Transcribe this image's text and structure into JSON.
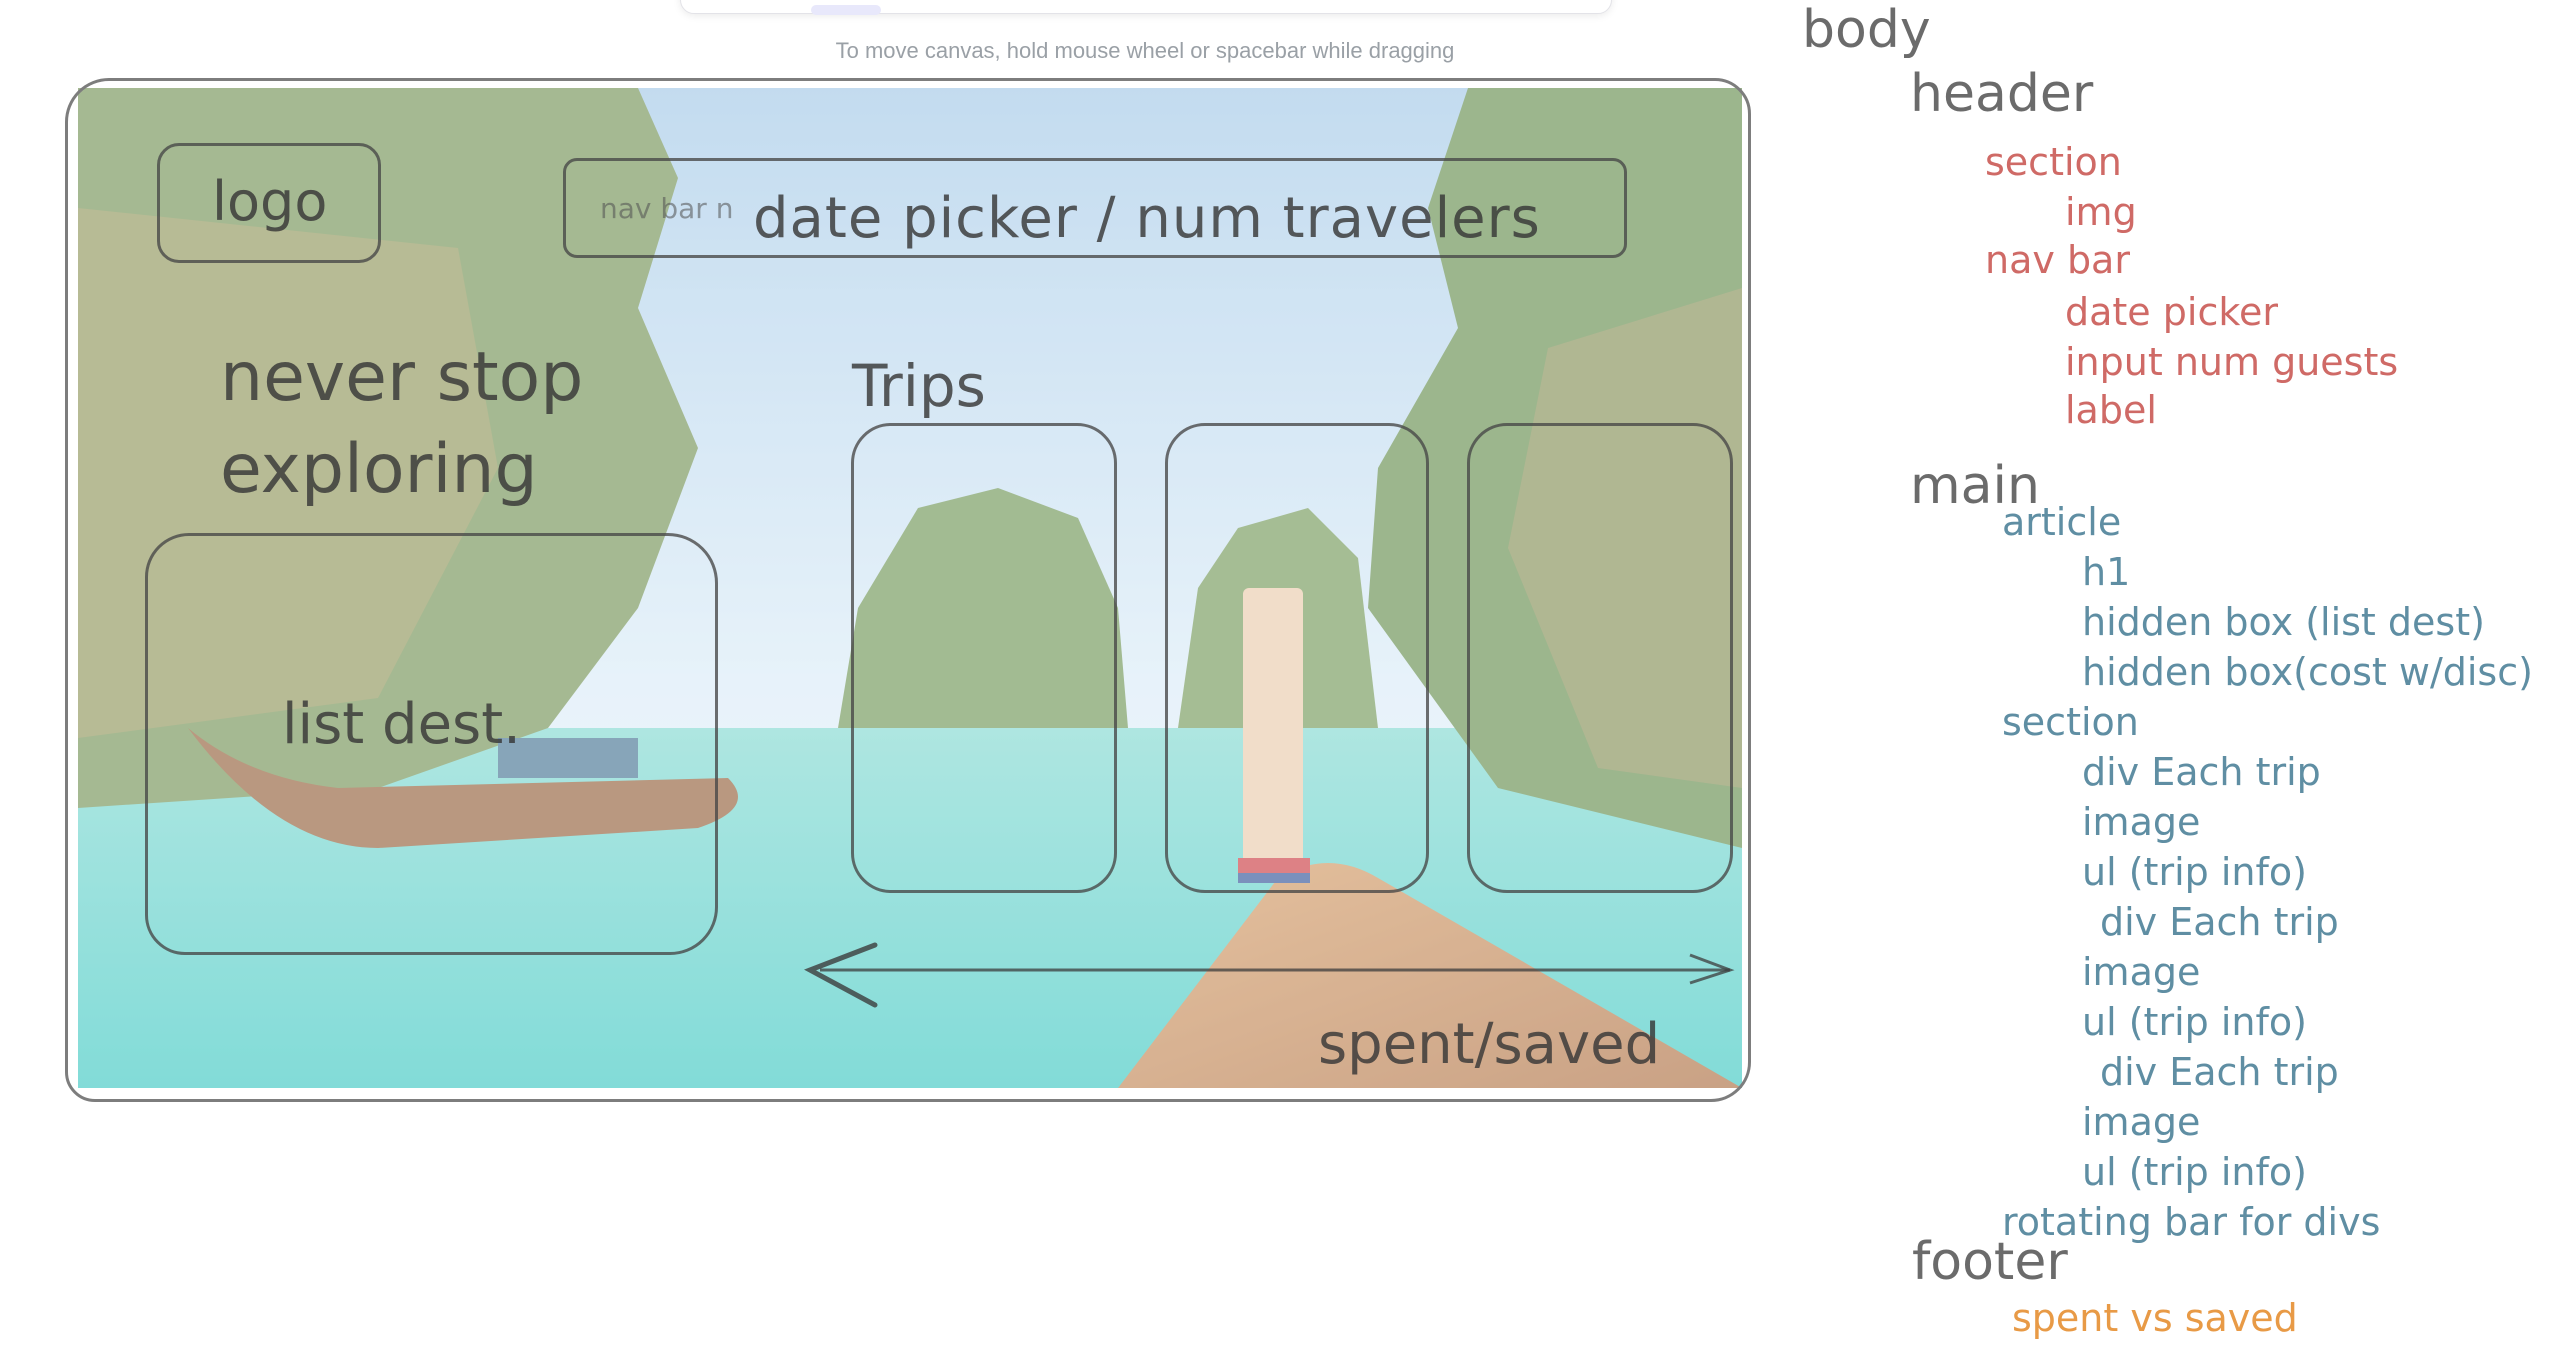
{
  "canvas": {
    "hint": "To move canvas, hold mouse wheel or spacebar while dragging"
  },
  "wireframe": {
    "logo": "logo",
    "nav_small": "nav bar n",
    "nav_big": "date picker / num travelers",
    "headline_line1": "never stop",
    "headline_line2": "exploring",
    "list_dest": "list dest.",
    "trips": "Trips",
    "spent_saved": "spent/saved"
  },
  "outline": {
    "body": "body",
    "header": "header",
    "header_section": "section",
    "img": "img",
    "nav_bar": "nav bar",
    "date_picker": "date picker",
    "input_guests": "input num guests",
    "label": "label",
    "main": "main",
    "article": "article",
    "h1": "h1",
    "hidden_list": "hidden box (list dest)",
    "hidden_cost": "hidden box(cost w/disc)",
    "main_section": "section",
    "trip1_div": "div Each trip",
    "trip1_image": "image",
    "trip1_ul": "ul (trip info)",
    "trip2_div": "div Each trip",
    "trip2_image": "image",
    "trip2_ul": "ul (trip info)",
    "trip3_div": "div Each trip",
    "trip3_image": "image",
    "trip3_ul": "ul (trip info)",
    "rotating": "rotating bar for divs",
    "footer": "footer",
    "spent_vs_saved": "spent vs saved"
  },
  "colors": {
    "gray": "#6b6b6b",
    "red": "#cf6a66",
    "blue": "#5f8ea3",
    "orange": "#e89a46"
  }
}
